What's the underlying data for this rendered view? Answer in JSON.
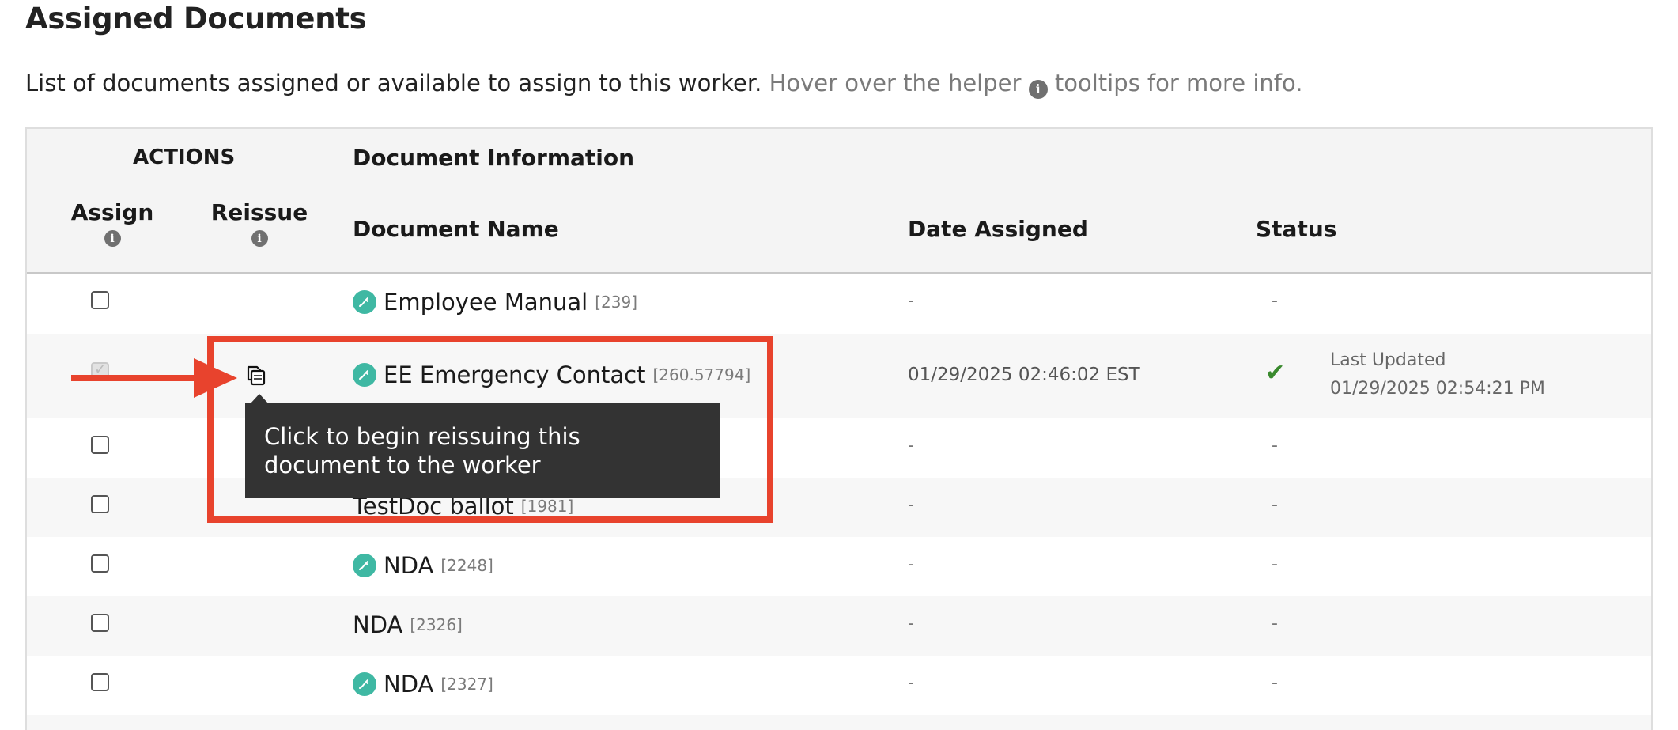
{
  "page": {
    "title": "Assigned Documents",
    "intro": "List of documents assigned or available to assign to this worker.",
    "hint_before": "Hover over the helper",
    "hint_after": "tooltips for more info."
  },
  "table": {
    "group_headers": {
      "actions": "ACTIONS",
      "doc_info": "Document Information"
    },
    "columns": {
      "assign": "Assign",
      "reissue": "Reissue",
      "doc_name": "Document Name",
      "date_assigned": "Date Assigned",
      "status": "Status"
    },
    "rows": [
      {
        "name": "Employee Manual",
        "id": "[239]",
        "date": "-",
        "status": "-"
      },
      {
        "name": "EE Emergency Contact",
        "id": "[260.57794]",
        "date": "01/29/2025 02:46:02 EST",
        "status_label": "Last Updated",
        "status_time": "01/29/2025 02:54:21 PM"
      },
      {
        "name": "",
        "id": "",
        "date": "-",
        "status": "-"
      },
      {
        "name": "TestDoc ballot",
        "id": "[1981]",
        "date": "-",
        "status": "-"
      },
      {
        "name": "NDA",
        "id": "[2248]",
        "date": "-",
        "status": "-"
      },
      {
        "name": "NDA",
        "id": "[2326]",
        "date": "-",
        "status": "-"
      },
      {
        "name": "NDA",
        "id": "[2327]",
        "date": "-",
        "status": "-"
      }
    ]
  },
  "tooltip": {
    "text": "Click to begin reissuing this document to the worker"
  },
  "icons": {
    "info": "info-icon",
    "signature": "signature-icon",
    "reissue": "copy-documents-icon",
    "status_check": "checkmark-icon"
  },
  "colors": {
    "annotation_red": "#e8432d",
    "signature_teal": "#3fb8a3",
    "check_green": "#3a8a2e",
    "tooltip_bg": "#333333"
  }
}
